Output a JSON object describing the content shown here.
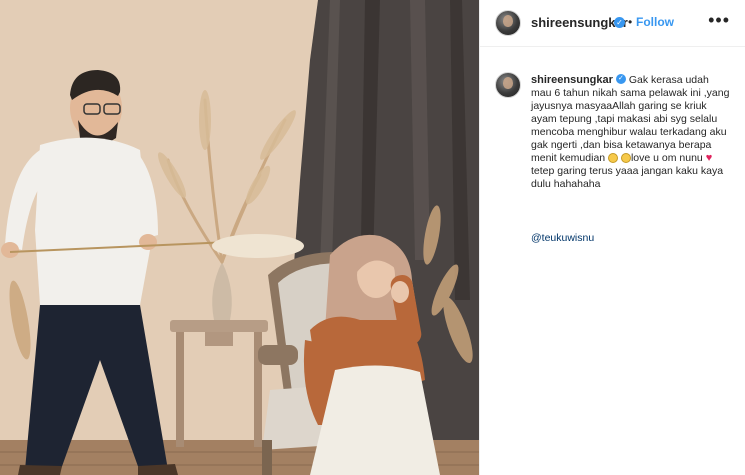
{
  "post": {
    "username": "shireensungkar",
    "verified_icon": "verified-badge-icon",
    "separator": "•",
    "follow_label": "Follow",
    "more_icon": "more-options-icon",
    "more_label": "•••"
  },
  "caption": {
    "username": "shireensungkar",
    "text_1": "Gak kerasa udah mau 6 tahun nikah sama pelawak ini ,yang jayusnya masyaaAllah garing se kriuk ayam tepung ,tapi makasi abi syg selalu mencoba menghibur walau terkadang aku gak ngerti ,dan bisa ketawanya berapa menit kemudian ",
    "text_2": "love u om nunu ",
    "text_3": " tetep garing terus yaaa jangan kaku kaya dulu hahahaha",
    "mention": "@teukuwisnu"
  },
  "colors": {
    "link_blue": "#3897f0",
    "mention_blue": "#003569",
    "text": "#262626"
  }
}
